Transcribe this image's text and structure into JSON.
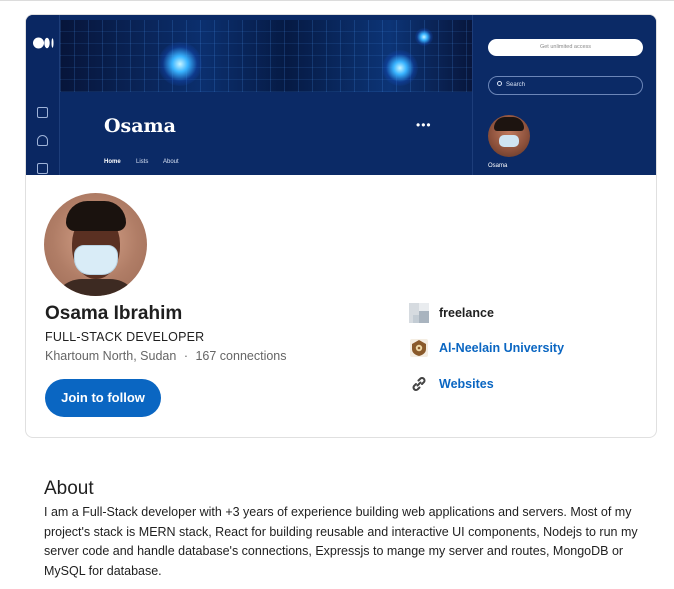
{
  "banner": {
    "site_title": "Osama",
    "more_label": "•••",
    "nav": [
      {
        "label": "Home"
      },
      {
        "label": "Lists"
      },
      {
        "label": "About"
      }
    ],
    "cta_label": "Get unlimited access",
    "search_placeholder": "Search",
    "author_name": "Osama"
  },
  "profile": {
    "name": "Osama Ibrahim",
    "headline": "FULL-STACK DEVELOPER",
    "location": "Khartoum North, Sudan",
    "separator": "·",
    "connections": "167 connections",
    "follow_label": "Join to follow"
  },
  "details": {
    "company": "freelance",
    "school": "Al-Neelain University",
    "websites": "Websites"
  },
  "about": {
    "title": "About",
    "text": "I am a Full-Stack developer with +3 years of experience building web applications and servers. Most of my project's stack is MERN stack, React for building reusable and interactive UI components, Nodejs to run my server code and handle database's connections, Expressjs to mange my server and routes, MongoDB or MySQL for database."
  },
  "colors": {
    "accent": "#0a66c2",
    "banner_bg": "#0b2a66"
  }
}
